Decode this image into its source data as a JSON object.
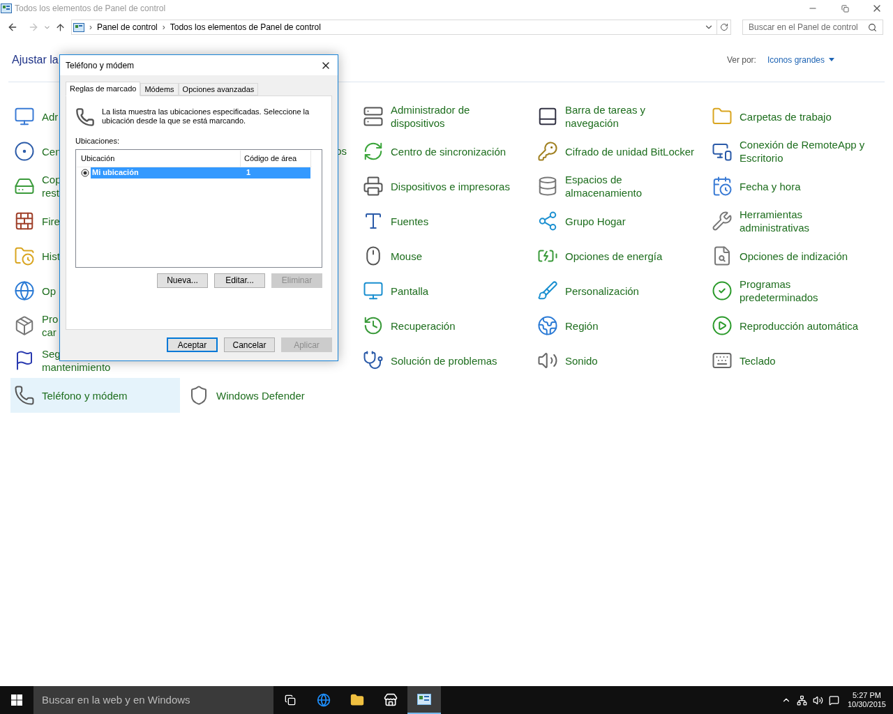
{
  "window": {
    "title": "Todos los elementos de Panel de control"
  },
  "address": {
    "separator": "›",
    "crumbs": [
      "Panel de control",
      "Todos los elementos de Panel de control"
    ],
    "search_placeholder": "Buscar en el Panel de control"
  },
  "header": {
    "title": "Ajustar la",
    "view_label": "Ver por:",
    "view_value": "Iconos grandes"
  },
  "rows": [
    [
      {
        "kind": "item",
        "label": "Adr",
        "selected": false
      },
      {
        "kind": "item",
        "label": "Administrador de dispositivos",
        "selected": false
      },
      {
        "kind": "item",
        "label": "Barra de tareas y navegación",
        "selected": false
      },
      {
        "kind": "item",
        "label": "Carpetas de trabajo",
        "selected": false
      }
    ],
    [
      {
        "kind": "item",
        "label": "Cen",
        "selected": false
      },
      {
        "kind": "fragment",
        "label": "os"
      },
      {
        "kind": "item",
        "label": "Centro de sincronización",
        "selected": false
      },
      {
        "kind": "item",
        "label": "Cifrado de unidad BitLocker",
        "selected": false
      },
      {
        "kind": "item",
        "label": "Conexión de RemoteApp y Escritorio",
        "selected": false
      }
    ],
    [
      {
        "kind": "item",
        "label": "Cop\nrest",
        "selected": false
      },
      {
        "kind": "item",
        "label": "Dispositivos e impresoras",
        "selected": false
      },
      {
        "kind": "item",
        "label": "Espacios de almacenamiento",
        "selected": false
      },
      {
        "kind": "item",
        "label": "Fecha y hora",
        "selected": false
      }
    ],
    [
      {
        "kind": "item",
        "label": "Fire",
        "selected": false
      },
      {
        "kind": "item",
        "label": "Fuentes",
        "selected": false
      },
      {
        "kind": "item",
        "label": "Grupo Hogar",
        "selected": false
      },
      {
        "kind": "item",
        "label": "Herramientas administrativas",
        "selected": false
      }
    ],
    [
      {
        "kind": "item",
        "label": "Hist",
        "selected": false
      },
      {
        "kind": "item",
        "label": "Mouse",
        "selected": false
      },
      {
        "kind": "item",
        "label": "Opciones de energía",
        "selected": false
      },
      {
        "kind": "item",
        "label": "Opciones de indización",
        "selected": false
      }
    ],
    [
      {
        "kind": "item",
        "label": "Op",
        "selected": false
      },
      {
        "kind": "item",
        "label": "Pantalla",
        "selected": false
      },
      {
        "kind": "item",
        "label": "Personalización",
        "selected": false
      },
      {
        "kind": "item",
        "label": "Programas predeterminados",
        "selected": false
      }
    ],
    [
      {
        "kind": "item",
        "label": "Pro\ncar",
        "selected": false
      },
      {
        "kind": "item",
        "label": "Recuperación",
        "selected": false
      },
      {
        "kind": "item",
        "label": "Región",
        "selected": false
      },
      {
        "kind": "item",
        "label": "Reproducción automática",
        "selected": false
      }
    ],
    [
      {
        "kind": "item",
        "label": "Seg\nmantenimiento",
        "selected": false
      },
      {
        "kind": "item",
        "label": "Solución de problemas",
        "selected": false
      },
      {
        "kind": "item",
        "label": "Sonido",
        "selected": false
      },
      {
        "kind": "item",
        "label": "Teclado",
        "selected": false
      }
    ],
    [
      {
        "kind": "item",
        "label": "Teléfono y módem",
        "selected": true
      },
      {
        "kind": "item",
        "label": "Windows Defender",
        "selected": false
      }
    ]
  ],
  "dialog": {
    "title": "Teléfono y módem",
    "tabs": [
      {
        "label": "Reglas de marcado",
        "selected": true
      },
      {
        "label": "Módems",
        "selected": false
      },
      {
        "label": "Opciones avanzadas",
        "selected": false
      }
    ],
    "description": "La lista muestra las ubicaciones especificadas. Seleccione la ubicación desde la que se está marcando.",
    "list_label": "Ubicaciones:",
    "columns": [
      "Ubicación",
      "Código de área"
    ],
    "locations": [
      {
        "name": "Mi ubicación",
        "area_code": "1",
        "selected": true
      }
    ],
    "list_buttons": [
      {
        "label": "Nueva...",
        "disabled": false
      },
      {
        "label": "Editar...",
        "disabled": false
      },
      {
        "label": "Eliminar",
        "disabled": true
      }
    ],
    "buttons": [
      {
        "label": "Aceptar",
        "disabled": false,
        "default": true
      },
      {
        "label": "Cancelar",
        "disabled": false,
        "default": false
      },
      {
        "label": "Aplicar",
        "disabled": true,
        "default": false
      }
    ]
  },
  "taskbar": {
    "search_placeholder": "Buscar en la web y en Windows",
    "time": "5:27 PM",
    "date": "10/30/2015"
  }
}
